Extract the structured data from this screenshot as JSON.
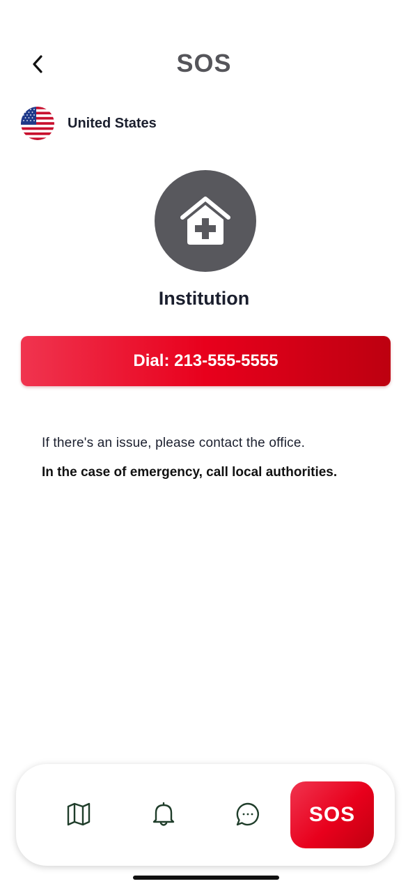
{
  "header": {
    "title": "SOS",
    "back_icon": "chevron-left-icon"
  },
  "country": {
    "name": "United States",
    "flag_icon": "us-flag-icon"
  },
  "institution": {
    "icon": "house-medical-icon",
    "title": "Institution"
  },
  "dial_button": {
    "label": "Dial: 213-555-5555"
  },
  "info": {
    "contact_text": "If there's an issue, please contact the office.",
    "emergency_text": "In the case of emergency, call local authorities."
  },
  "bottom_nav": {
    "items": [
      {
        "icon": "map-icon"
      },
      {
        "icon": "bell-icon"
      },
      {
        "icon": "chat-bubble-icon"
      }
    ],
    "sos_label": "SOS"
  },
  "colors": {
    "accent_red": "#e8001c",
    "icon_gray": "#58585d",
    "nav_icon_green": "#1f3d2a",
    "text_dark": "#1b1f2e"
  }
}
